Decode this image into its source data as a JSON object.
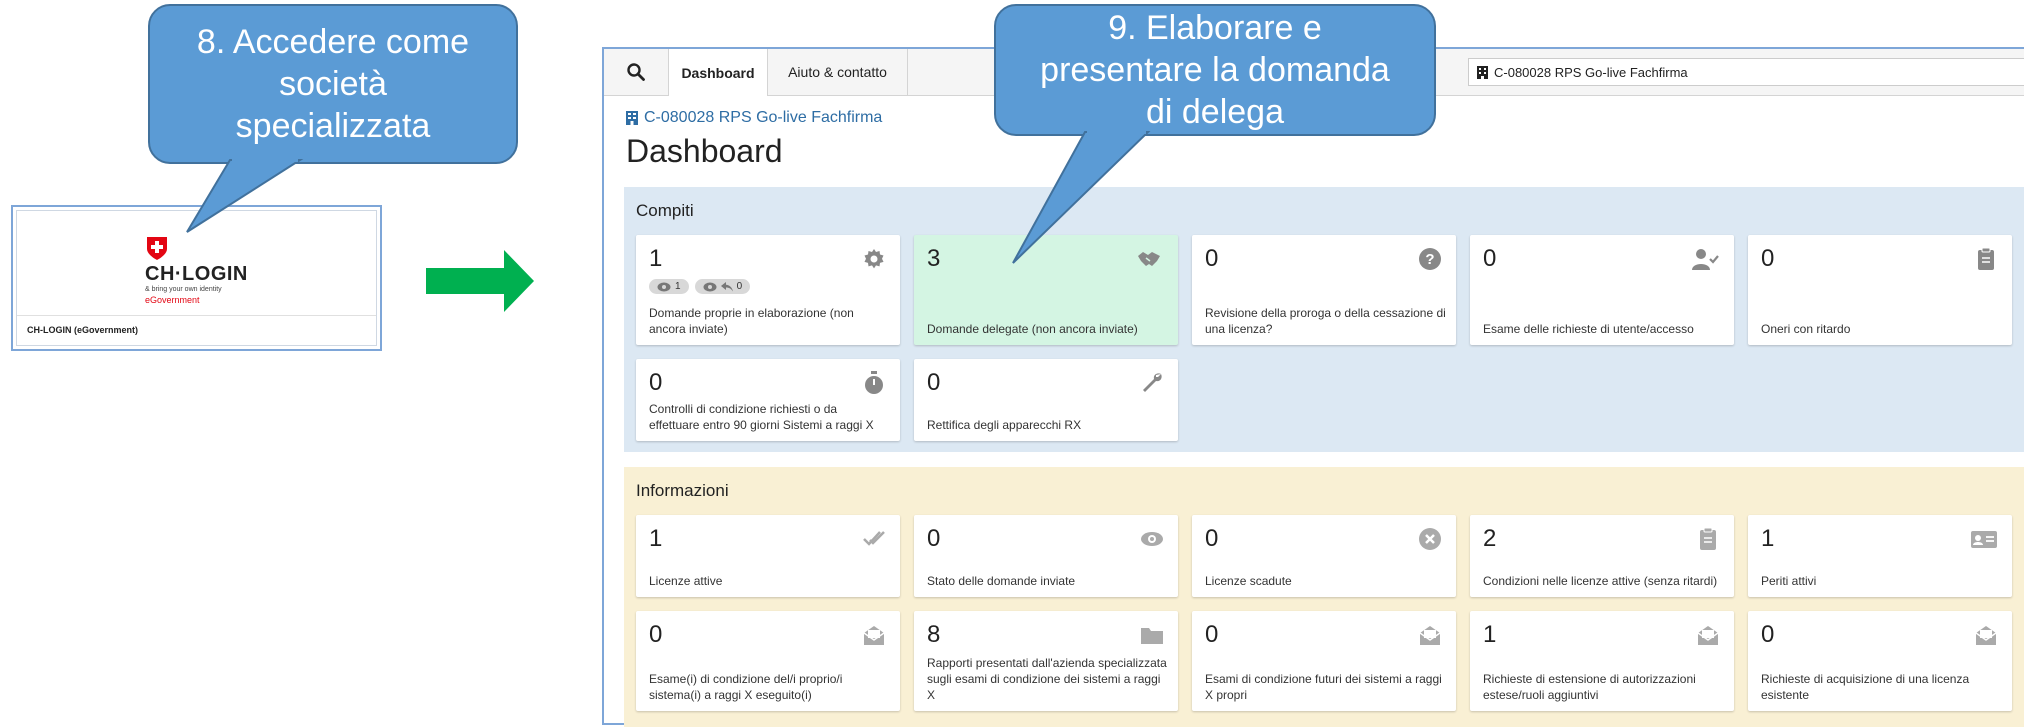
{
  "callouts": {
    "step8": "8. Accedere come società specializzata",
    "step9": "9. Elaborare e presentare la domanda di delega"
  },
  "login": {
    "brand": "CH·LOGIN",
    "tagline": "& bring your own identity",
    "sub": "eGovernment",
    "footer": "CH-LOGIN (eGovernment)"
  },
  "nav": {
    "tabs": [
      "Dashboard",
      "Aiuto & contatto"
    ],
    "org_selector": "C-080028 RPS Go-live Fachfirma"
  },
  "page": {
    "org_link": "C-080028 RPS Go-live Fachfirma",
    "title": "Dashboard"
  },
  "sections": {
    "tasks": {
      "title": "Compiti",
      "cards": [
        {
          "count": "1",
          "label": "Domande proprie in elaborazione (non ancora inviate)",
          "icon": "gear-icon",
          "pills": [
            "1",
            "0"
          ]
        },
        {
          "count": "3",
          "label": "Domande delegate (non ancora inviate)",
          "icon": "handshake-icon"
        },
        {
          "count": "0",
          "label": "Revisione della proroga o della cessazione di una licenza?",
          "icon": "question-icon"
        },
        {
          "count": "0",
          "label": "Esame delle richieste di utente/accesso",
          "icon": "user-check-icon"
        },
        {
          "count": "0",
          "label": "Oneri con ritardo",
          "icon": "clipboard-icon"
        },
        {
          "count": "0",
          "label": "Controlli di condizione richiesti o da effettuare entro 90 giorni Sistemi a raggi X",
          "icon": "stopwatch-icon"
        },
        {
          "count": "0",
          "label": "Rettifica degli apparecchi RX",
          "icon": "wrench-icon"
        }
      ]
    },
    "info": {
      "title": "Informazioni",
      "cards": [
        {
          "count": "1",
          "label": "Licenze attive",
          "icon": "double-check-icon"
        },
        {
          "count": "0",
          "label": "Stato delle domande inviate",
          "icon": "eye-icon"
        },
        {
          "count": "0",
          "label": "Licenze scadute",
          "icon": "x-circle-icon"
        },
        {
          "count": "2",
          "label": "Condizioni nelle licenze attive (senza ritardi)",
          "icon": "clipboard-icon"
        },
        {
          "count": "1",
          "label": "Periti attivi",
          "icon": "id-card-icon"
        },
        {
          "count": "0",
          "label": "Esame(i) di condizione del/i proprio/i sistema(i) a raggi X eseguito(i)",
          "icon": "envelope-open-icon"
        },
        {
          "count": "8",
          "label": "Rapporti presentati dall'azienda specializzata sugli esami di condizione dei sistemi a raggi X",
          "icon": "folder-icon"
        },
        {
          "count": "0",
          "label": "Esami di condizione futuri dei sistemi a raggi X propri",
          "icon": "envelope-open-icon"
        },
        {
          "count": "1",
          "label": "Richieste di estensione di autorizzazioni estese/ruoli aggiuntivi",
          "icon": "envelope-open-icon"
        },
        {
          "count": "0",
          "label": "Richieste di acquisizione di una licenza esistente",
          "icon": "envelope-open-icon"
        }
      ]
    }
  },
  "colors": {
    "callout": "#5b9bd5",
    "arrow": "#00b050",
    "tasks_bg": "#dce8f3",
    "info_bg": "#f9f0d4",
    "highlight_card": "#d4f5e3",
    "swiss_red": "#e30613"
  }
}
